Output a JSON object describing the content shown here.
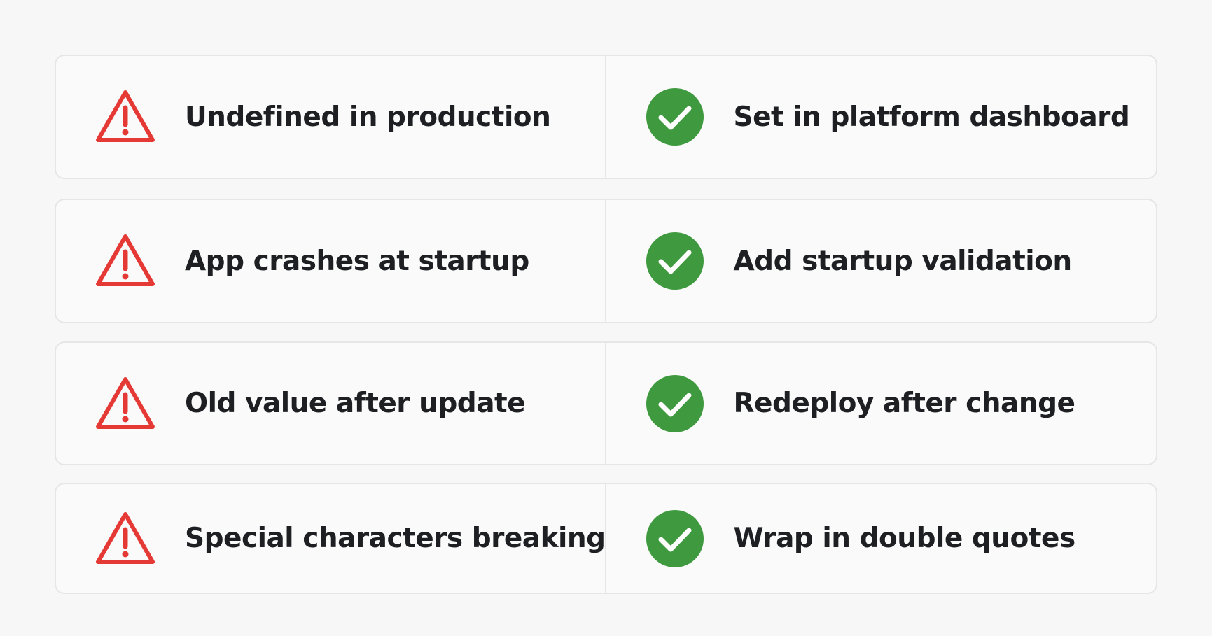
{
  "colors": {
    "warning": "#e53935",
    "success": "#3f9a3f",
    "text": "#1d1f22",
    "card_border": "#e6e6e6"
  },
  "rows": [
    {
      "problem": {
        "icon": "warning-triangle-icon",
        "text": "Undefined in production"
      },
      "solution": {
        "icon": "check-circle-icon",
        "text": "Set in platform dashboard"
      }
    },
    {
      "problem": {
        "icon": "warning-triangle-icon",
        "text": "App crashes at startup"
      },
      "solution": {
        "icon": "check-circle-icon",
        "text": "Add startup validation"
      }
    },
    {
      "problem": {
        "icon": "warning-triangle-icon",
        "text": "Old value after update"
      },
      "solution": {
        "icon": "check-circle-icon",
        "text": "Redeploy after change"
      }
    },
    {
      "problem": {
        "icon": "warning-triangle-icon",
        "text": "Special characters breaking"
      },
      "solution": {
        "icon": "check-circle-icon",
        "text": "Wrap in double quotes"
      }
    }
  ]
}
